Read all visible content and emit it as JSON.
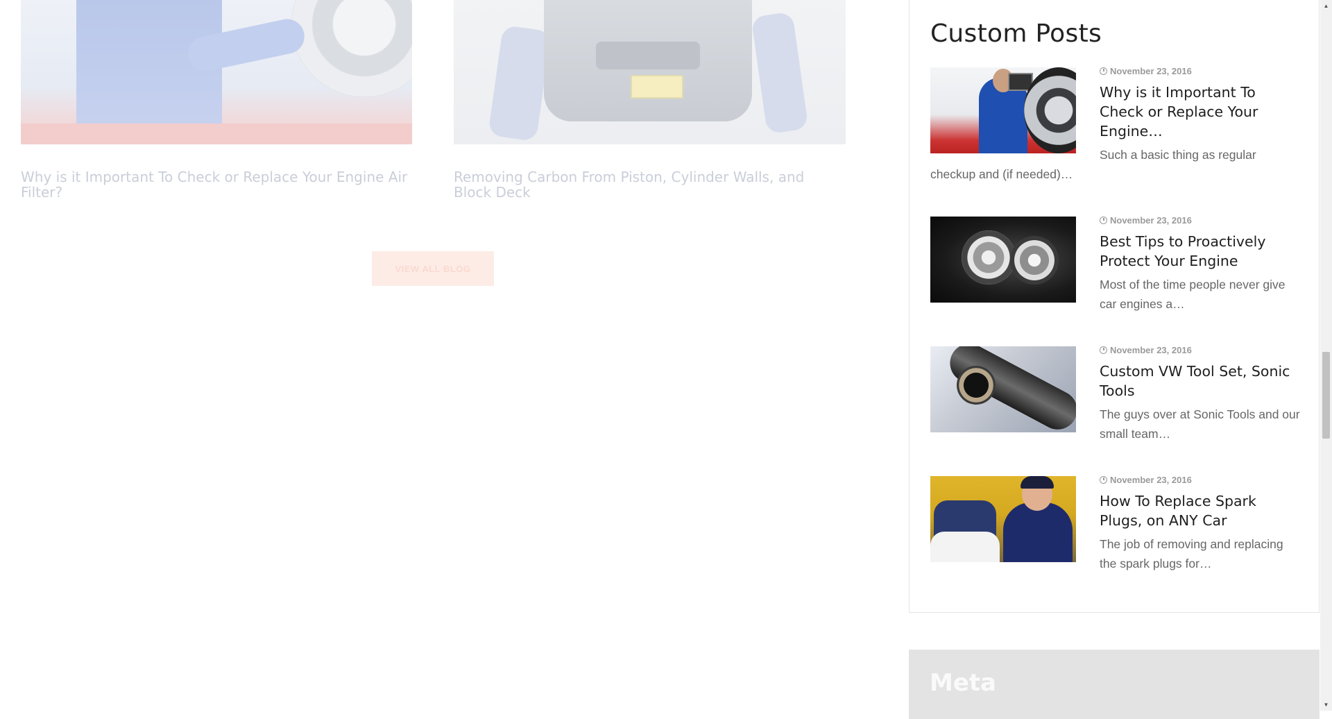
{
  "blog": {
    "cards": [
      {
        "title": "Why is it Important To Check or Replace Your Engine Air Filter?"
      },
      {
        "title": "Removing Carbon From Piston, Cylinder Walls, and Block Deck"
      }
    ],
    "view_all_label": "VIEW ALL BLOG"
  },
  "sidebar": {
    "custom_posts": {
      "title": "Custom Posts",
      "posts": [
        {
          "date": "November 23, 2016",
          "title": "Why is it Important To Check or Replace Your Engine…",
          "excerpt": "Such a basic thing as regular checkup and (if needed)…"
        },
        {
          "date": "November 23, 2016",
          "title": "Best Tips to Proactively Protect Your Engine",
          "excerpt": "Most of the time people never give car engines a…"
        },
        {
          "date": "November 23, 2016",
          "title": "Custom VW Tool Set, Sonic Tools",
          "excerpt": "The guys over at Sonic Tools and our small team…"
        },
        {
          "date": "November 23, 2016",
          "title": "How To Replace Spark Plugs, on ANY Car",
          "excerpt": "The job of removing and replacing the spark plugs for…"
        }
      ]
    },
    "meta": {
      "title": "Meta"
    }
  },
  "icons": {
    "clock": "clock-icon",
    "scroll_up": "arrow-up-icon",
    "scroll_down": "arrow-down-icon"
  },
  "colors": {
    "accent_button_bg": "#fdece6",
    "accent_button_text": "#fbd9cf",
    "meta_bg": "#e3e3e3"
  }
}
